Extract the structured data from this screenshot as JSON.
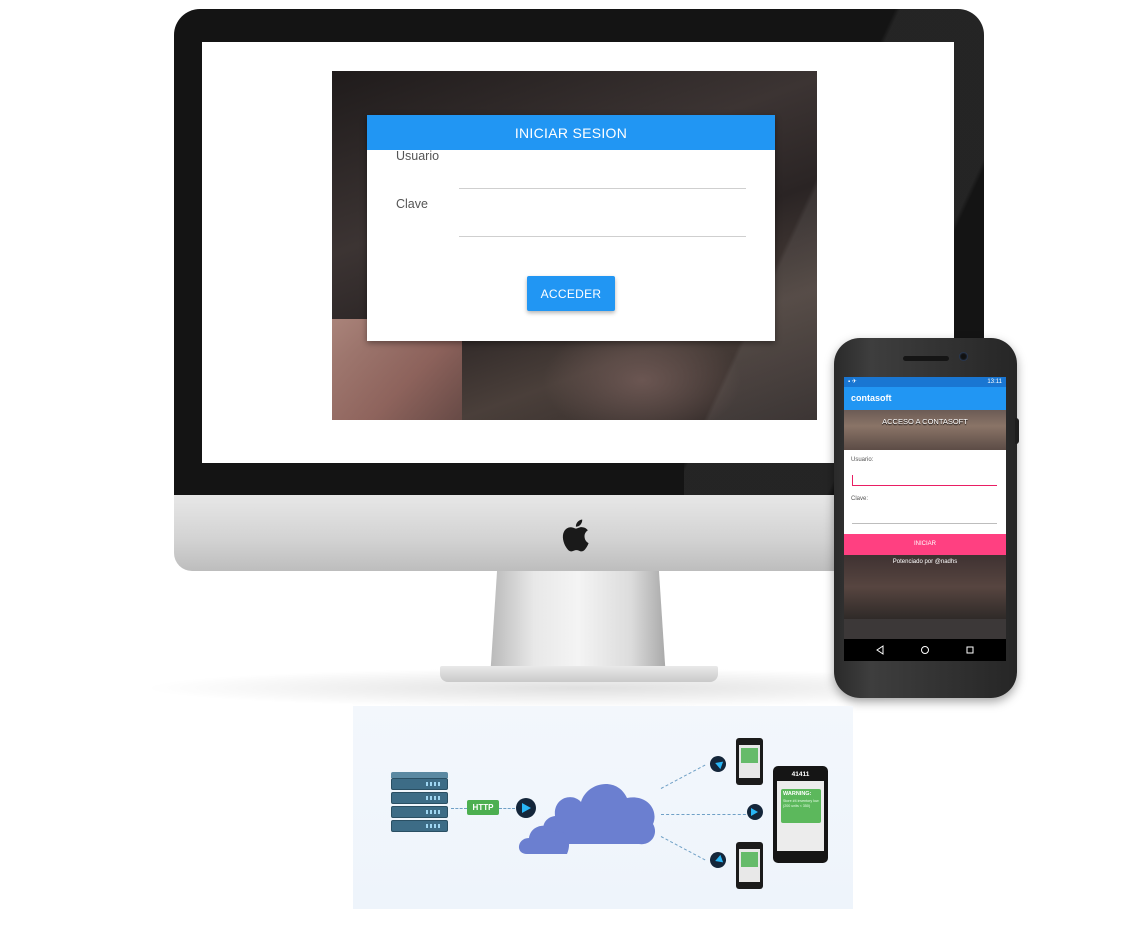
{
  "desktop_app": {
    "header_title": "INICIAR SESION",
    "username_label": "Usuario",
    "password_label": "Clave",
    "submit_label": "ACCEDER"
  },
  "mobile_app": {
    "status_time": "13:11",
    "app_title": "contasoft",
    "hero_title": "ACCESO A CONTASOFT",
    "username_label": "Usuario:",
    "password_label": "Clave:",
    "submit_label": "INICIAR",
    "footer_text": "Potenciado por @nadhs"
  },
  "diagram": {
    "http_label": "HTTP",
    "sms_number": "41411",
    "sms_title": "WARNING:",
    "sms_body": "Store #4 inventory low (200 units < 350)",
    "colors": {
      "cloud": "#6b7fd0",
      "http_badge": "#4caf50",
      "server": "#3d6c86"
    }
  },
  "colors": {
    "primary_blue": "#2196f3",
    "accent_pink": "#ff4081"
  }
}
